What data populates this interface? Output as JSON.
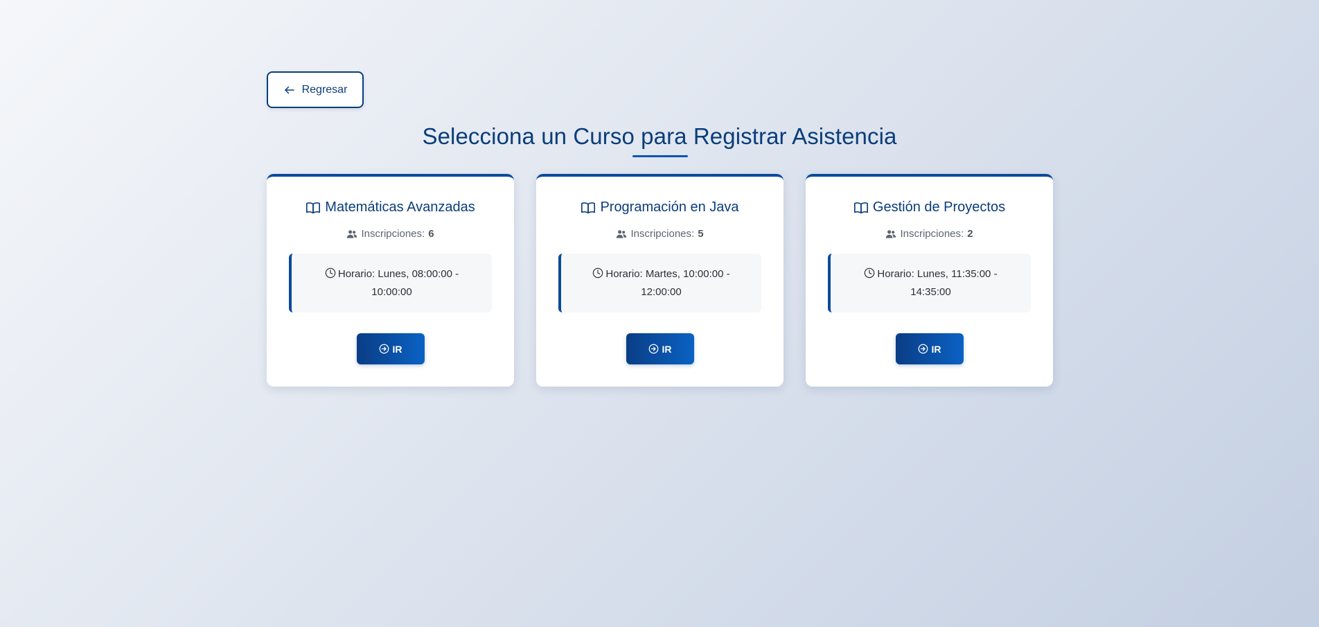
{
  "back_button": {
    "label": "Regresar",
    "icon": "arrow-left-icon"
  },
  "page_title": "Selecciona un Curso para Registrar Asistencia",
  "courses": [
    {
      "name": "Matemáticas Avanzadas",
      "enroll_label": "Inscripciones:",
      "enroll_count": "6",
      "schedule_line1": "Horario: Lunes, 08:00:00 -",
      "schedule_line2": "10:00:00",
      "button_label": "IR"
    },
    {
      "name": "Programación en Java",
      "enroll_label": "Inscripciones:",
      "enroll_count": "5",
      "schedule_line1": "Horario: Martes, 10:00:00 -",
      "schedule_line2": "12:00:00",
      "button_label": "IR"
    },
    {
      "name": "Gestión de Proyectos",
      "enroll_label": "Inscripciones:",
      "enroll_count": "2",
      "schedule_line1": "Horario: Lunes, 11:35:00 -",
      "schedule_line2": "14:35:00",
      "button_label": "IR"
    }
  ],
  "colors": {
    "primary": "#0a3d7a",
    "accent": "#0a56b0",
    "button_gradient_start": "#0a3d85",
    "button_gradient_end": "#0a62c4",
    "schedule_bg": "#f6f7f9"
  },
  "icons": {
    "course": "book-open-icon",
    "enroll": "users-icon",
    "schedule": "clock-icon",
    "go": "arrow-circle-right-icon"
  }
}
